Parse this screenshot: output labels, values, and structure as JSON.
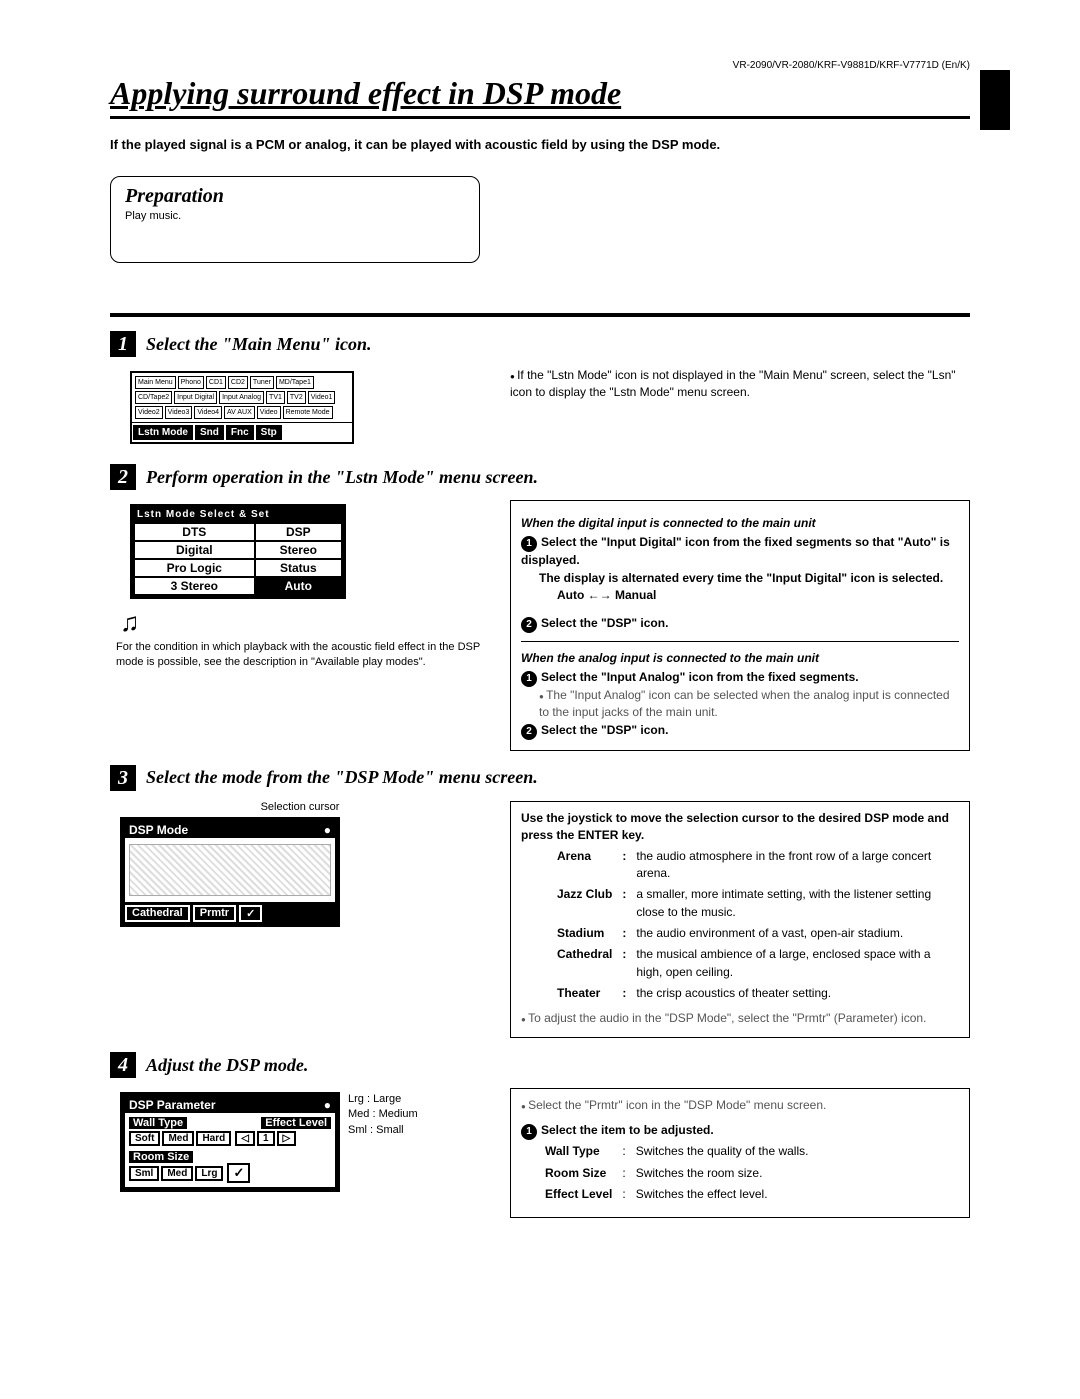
{
  "header": {
    "model": "VR-2090/VR-2080/KRF-V9881D/KRF-V7771D (En/K)"
  },
  "title": "Applying surround effect in DSP mode",
  "intro": "If the played signal is a PCM or analog, it can be played with acoustic field by using the DSP mode.",
  "prep": {
    "heading": "Preparation",
    "sub": "Play music."
  },
  "step1": {
    "num": "1",
    "title": "Select the \"Main Menu\" icon.",
    "note": "If the \"Lstn Mode\" icon is not displayed in the \"Main Menu\" screen, select the \"Lsn\" icon to display the \"Lstn Mode\" menu screen.",
    "lcd": {
      "icons": [
        "Main Menu",
        "Phono",
        "CD1",
        "CD2",
        "Tuner",
        "MD/Tape1",
        "CD/Tape2",
        "Input Digital",
        "Input Analog",
        "TV1",
        "TV2",
        "Video1",
        "Video2",
        "Video3",
        "Video4",
        "AV AUX",
        "Video",
        "Remote Mode"
      ],
      "footer": [
        "Lstn Mode",
        "Snd",
        "Fnc",
        "Stp"
      ]
    }
  },
  "step2": {
    "num": "2",
    "title": "Perform operation in the \"Lstn Mode\" menu screen.",
    "lcd": {
      "hdr": "Lstn Mode    Select & Set",
      "rows": [
        [
          "DTS",
          "DSP"
        ],
        [
          "Digital",
          "Stereo"
        ],
        [
          "Pro Logic",
          "Status"
        ],
        [
          "3 Stereo",
          "Auto"
        ]
      ]
    },
    "caption": "For the condition in which playback with the acoustic field effect in the DSP mode is possible, see the description in \"Available play modes\".",
    "digital": {
      "heading": "When the digital input is connected to the main unit",
      "s1a": "Select the \"Input Digital\" icon from the fixed segments so that \"Auto\" is displayed.",
      "s1b": "The display is alternated every time the \"Input Digital\" icon is selected.",
      "s1c": "Auto ←→ Manual",
      "s2": "Select the \"DSP\" icon."
    },
    "analog": {
      "heading": "When the analog input is connected to the main unit",
      "s1": "Select the \"Input Analog\" icon from the fixed segments.",
      "s1note": "The \"Input Analog\" icon can be selected when the analog input is connected to the input jacks of the main unit.",
      "s2": "Select the \"DSP\" icon."
    }
  },
  "step3": {
    "num": "3",
    "title": "Select the mode from the \"DSP Mode\" menu screen.",
    "sel_label": "Selection cursor",
    "lcd": {
      "title": "DSP Mode",
      "footer": [
        "Cathedral",
        "Prmtr",
        "✓"
      ]
    },
    "intro": "Use the joystick to move the selection cursor to the desired DSP mode and press the ENTER key.",
    "modes": {
      "Arena": "the audio atmosphere in the front row of a large concert arena.",
      "Jazz Club": "a smaller, more intimate setting, with the listener setting close to the music.",
      "Stadium": "the audio environment of a vast, open-air stadium.",
      "Cathedral": "the musical ambience of a large, enclosed space with a high, open ceiling.",
      "Theater": "the crisp acoustics of theater setting."
    },
    "footnote": "To adjust the audio in the \"DSP Mode\", select the \"Prmtr\" (Parameter) icon."
  },
  "step4": {
    "num": "4",
    "title": "Adjust the DSP mode.",
    "lcd": {
      "title": "DSP Parameter",
      "wall_label": "Wall Type",
      "wall_opts": [
        "Soft",
        "Med",
        "Hard"
      ],
      "room_label": "Room Size",
      "room_opts": [
        "Sml",
        "Med",
        "Lrg"
      ],
      "effect_label": "Effect Level",
      "effect_ctrl": [
        "◁",
        "1",
        "▷"
      ]
    },
    "key": {
      "l1": "Lrg : Large",
      "l2": "Med : Medium",
      "l3": "Sml : Small"
    },
    "r1": "Select the \"Prmtr\" icon in the \"DSP Mode\" menu screen.",
    "r2": "Select the item to be adjusted.",
    "items": {
      "Wall Type": "Switches the quality of the walls.",
      "Room Size": "Switches the room size.",
      "Effect Level": "Switches the effect level."
    }
  }
}
